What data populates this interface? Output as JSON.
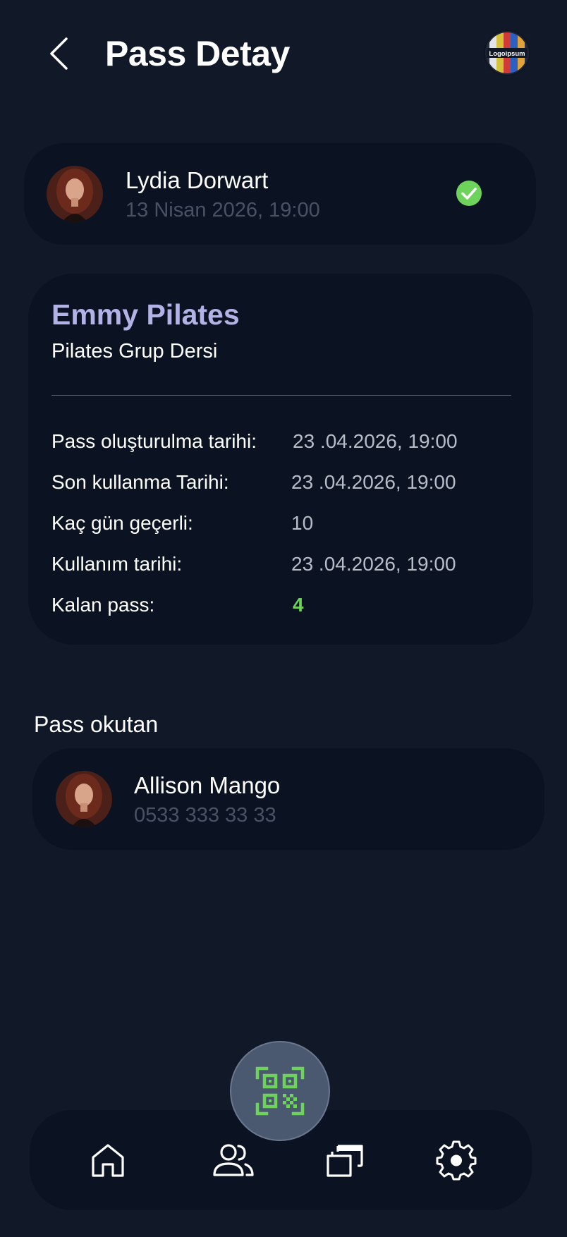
{
  "header": {
    "title": "Pass Detay",
    "logo_text": "Logoipsum"
  },
  "user": {
    "name": "Lydia Dorwart",
    "date": "13 Nisan 2026, 19:00",
    "status": "verified"
  },
  "pass": {
    "title": "Emmy Pilates",
    "subtitle": "Pilates Grup Dersi",
    "rows": [
      {
        "label": "Pass oluşturulma tarihi:",
        "value": "23 .04.2026, 19:00"
      },
      {
        "label": "Son kullanma Tarihi:",
        "value": "23 .04.2026, 19:00"
      },
      {
        "label": "Kaç gün geçerli:",
        "value": "10"
      },
      {
        "label": "Kullanım tarihi:",
        "value": "23 .04.2026, 19:00"
      },
      {
        "label": "Kalan pass:",
        "value": "4"
      }
    ]
  },
  "scanner": {
    "section_title": "Pass okutan",
    "name": "Allison Mango",
    "phone": "0533 333 33 33"
  },
  "nav": {
    "items": [
      "home-icon",
      "users-icon",
      "cards-icon",
      "settings-icon"
    ],
    "fab": "qr-code-icon"
  },
  "colors": {
    "background": "#111828",
    "card": "#0b1222",
    "accent_green": "#6ed35a",
    "title_lavender": "#b3b2e6"
  }
}
